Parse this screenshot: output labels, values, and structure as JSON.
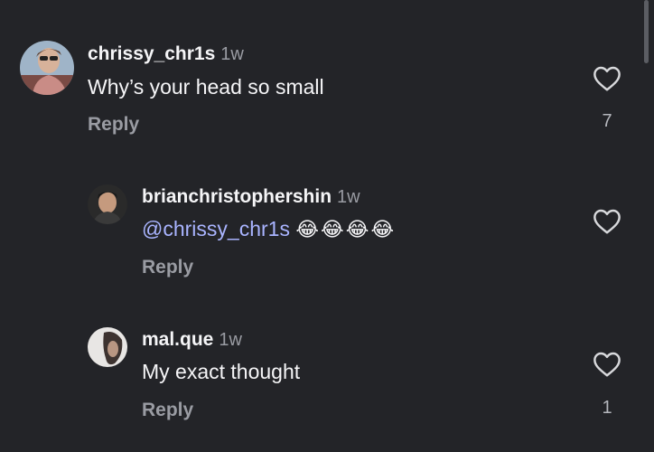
{
  "comments": [
    {
      "username": "chrissy_chr1s",
      "time": "1w",
      "text": "Why’s your head so small",
      "reply_label": "Reply",
      "likes": "7"
    },
    {
      "username": "brianchristophershin",
      "time": "1w",
      "mention": "@chrissy_chr1s",
      "emojis": "😂😂😂😂",
      "reply_label": "Reply",
      "likes": ""
    },
    {
      "username": "mal.que",
      "time": "1w",
      "text": "My exact thought",
      "reply_label": "Reply",
      "likes": "1"
    }
  ],
  "icons": {
    "like": "heart-outline-icon"
  },
  "colors": {
    "background": "#232428",
    "mention": "#a9b4ff",
    "secondary_text": "#9a9ca3"
  }
}
